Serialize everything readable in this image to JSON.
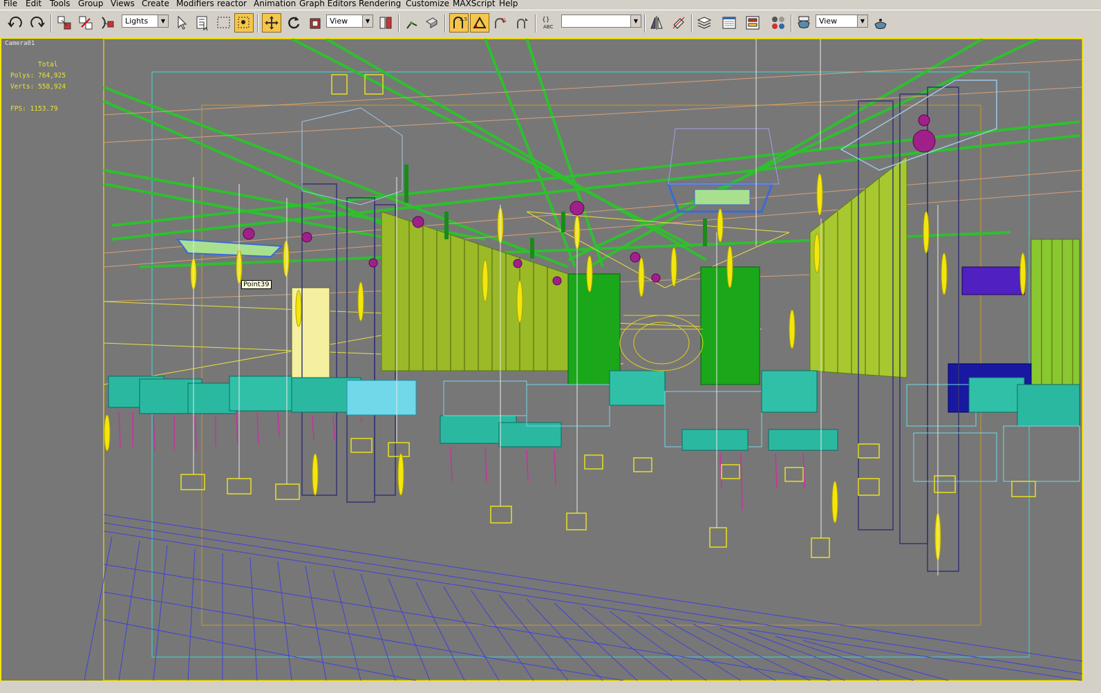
{
  "menu": [
    "File",
    "Edit",
    "Tools",
    "Group",
    "Views",
    "Create",
    "Modifiers",
    "reactor",
    "Animation",
    "Graph Editors",
    "Rendering",
    "Customize",
    "MAXScript",
    "Help"
  ],
  "toolbar": {
    "selection_filter": "Lights",
    "ref_coord": "View",
    "named_selection": "",
    "render_view": "View",
    "icons": [
      "undo-icon",
      "redo-icon",
      "select-and-link-icon",
      "unlink-icon",
      "bind-space-warp-icon",
      "select-object-icon",
      "select-by-name-icon",
      "rectangular-selection-region-icon",
      "window-crossing-icon",
      "select-and-move-icon",
      "select-and-rotate-icon",
      "select-and-scale-icon",
      "use-pivot-center-icon",
      "select-manipulate-icon",
      "snaps-toggle-icon",
      "angle-snap-icon",
      "percent-snap-icon",
      "spinner-snap-icon",
      "edit-named-selection-icon",
      "mirror-icon",
      "align-icon",
      "layer-manager-icon",
      "curve-editor-icon",
      "schematic-view-icon",
      "material-editor-icon",
      "render-scene-icon",
      "quick-render-icon"
    ]
  },
  "viewport": {
    "label": "Camera01",
    "stats_title": "Total",
    "polys": "Polys: 764,925",
    "verts": "Verts: 558,924",
    "fps": "FPS:   1153.79",
    "tooltip": "Point39",
    "border_color": "#f3e60d",
    "background": "#777777"
  }
}
